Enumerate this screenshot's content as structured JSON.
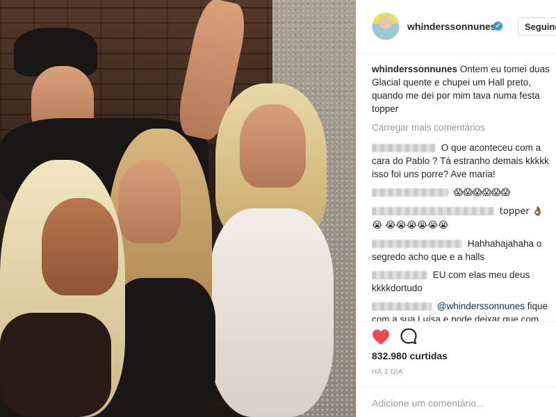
{
  "post": {
    "username": "whinderssonnunes",
    "verified_glyph": "✓",
    "follow_label": "Seguindo"
  },
  "caption": {
    "username": "whinderssonnunes",
    "text": "Ontem eu tomei duas Glacial quente e chupei um Hall preto, quando me dei por mim tava numa festa topper"
  },
  "load_more": "Carregar mais comentários",
  "comments": [
    {
      "text": "O que aconteceu com a cara do Pablo ? Tá estranho demais kkkkk isso foi uns porre? Ave maria!"
    },
    {
      "text": "😱😱😱😱😱😱"
    },
    {
      "text": "topper 👌🏾😭 😭😭😭😭😭😭"
    },
    {
      "text": "Hahhahajahaha o segredo acho que e a halls"
    },
    {
      "text": "EU com elas meu deus kkkkdortudo"
    },
    {
      "mention": "@whinderssonnunes",
      "text": " fique com a sua Luísa e pode deixar que com essas duas loiras restante eu dou conta do"
    }
  ],
  "likes": "832.980 curtidas",
  "timestamp": "HÁ 1 DIA",
  "add_comment_placeholder": "Adicione um comentário...",
  "colors": {
    "heart": "#ed4956",
    "verified": "#3897f0",
    "muted": "#999999",
    "mention": "#003569"
  },
  "icons": [
    "verified-icon",
    "heart-icon",
    "comment-icon"
  ]
}
